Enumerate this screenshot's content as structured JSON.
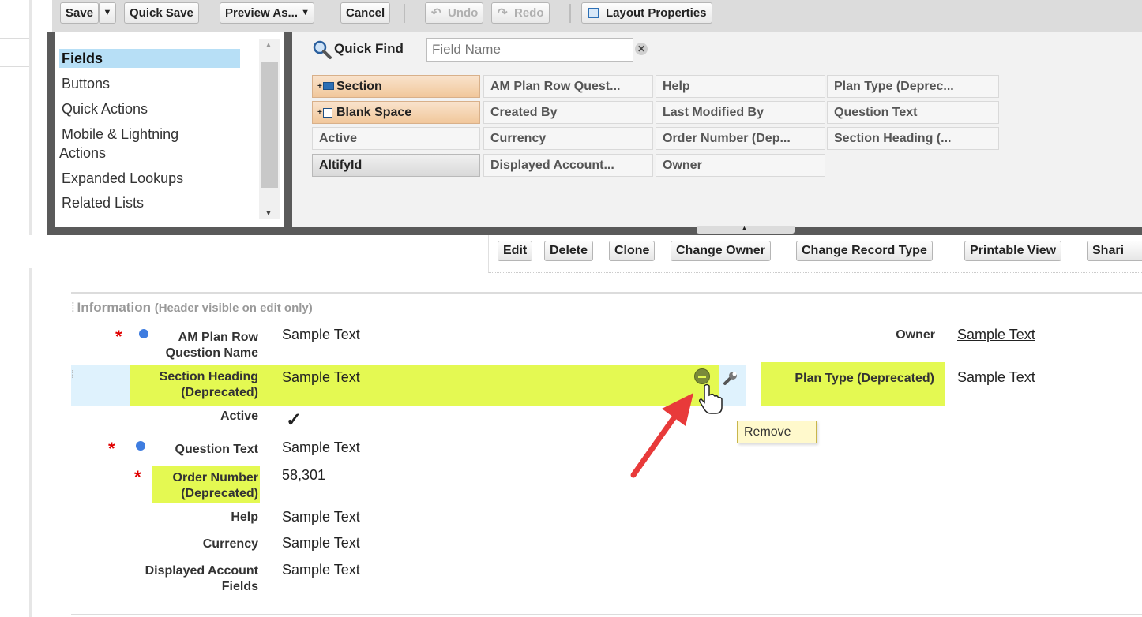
{
  "toolbar": {
    "save": "Save",
    "quick_save": "Quick Save",
    "preview_as": "Preview As...",
    "cancel": "Cancel",
    "undo": "Undo",
    "redo": "Redo",
    "layout_properties": "Layout Properties"
  },
  "palette": {
    "categories": [
      "Fields",
      "Buttons",
      "Quick Actions",
      "Mobile & Lightning",
      "Actions",
      "Expanded Lookups",
      "Related Lists"
    ],
    "quick_find_label": "Quick Find",
    "quick_find_placeholder": "Field Name",
    "fields": [
      "Section",
      "Blank Space",
      "Active",
      "AltifyId",
      "AM Plan Row Quest...",
      "Created By",
      "Currency",
      "Displayed Account...",
      "Help",
      "Last Modified By",
      "Order Number (Dep...",
      "Owner",
      "Plan Type (Deprec...",
      "Question Text",
      "Section Heading (..."
    ]
  },
  "actions": [
    "Edit",
    "Delete",
    "Clone",
    "Change Owner",
    "Change Record Type",
    "Printable View",
    "Shari"
  ],
  "section": {
    "title": "Information",
    "note": "(Header visible on edit only)"
  },
  "fields": {
    "am_plan_row": {
      "label": [
        "AM Plan Row",
        "Question Name"
      ],
      "value": "Sample Text"
    },
    "section_heading": {
      "label": [
        "Section Heading",
        "(Deprecated)"
      ],
      "value": "Sample Text"
    },
    "active": {
      "label": "Active",
      "value": "✓"
    },
    "question_text": {
      "label": "Question Text",
      "value": "Sample Text"
    },
    "order_number": {
      "label": [
        "Order Number",
        "(Deprecated)"
      ],
      "value": "58,301"
    },
    "help": {
      "label": "Help",
      "value": "Sample Text"
    },
    "currency": {
      "label": "Currency",
      "value": "Sample Text"
    },
    "displayed_account": {
      "label": [
        "Displayed Account",
        "Fields"
      ],
      "value": "Sample Text"
    },
    "owner": {
      "label": "Owner",
      "value": "Sample Text"
    },
    "plan_type": {
      "label": "Plan Type (Deprecated)",
      "value": "Sample Text"
    }
  },
  "tooltip": "Remove",
  "colors": {
    "highlight": "#e4f952",
    "row_select": "#dff2fd",
    "required": "#e00000",
    "info_dot": "#3f7de0",
    "arrow": "#e83a3a"
  },
  "icons": [
    "search-icon",
    "clear-icon",
    "undo-icon",
    "redo-icon",
    "layout-properties-icon",
    "remove-icon",
    "wrench-icon",
    "hand-cursor-icon"
  ]
}
